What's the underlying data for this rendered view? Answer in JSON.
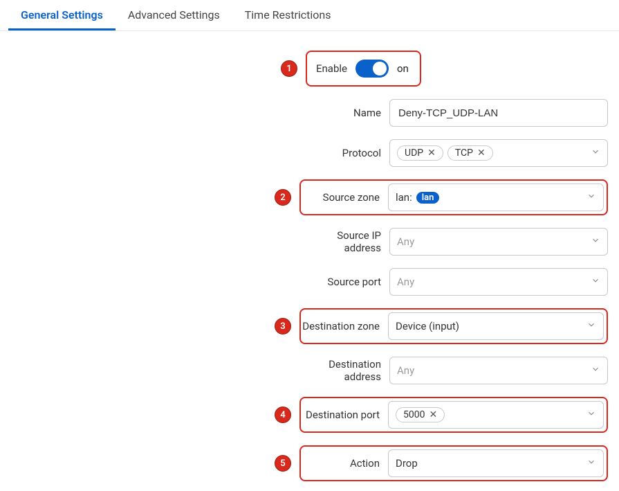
{
  "tabs": {
    "general": "General Settings",
    "advanced": "Advanced Settings",
    "time": "Time Restrictions"
  },
  "markers": {
    "m1": "1",
    "m2": "2",
    "m3": "3",
    "m4": "4",
    "m5": "5"
  },
  "form": {
    "enable": {
      "label": "Enable",
      "state": "on"
    },
    "name": {
      "label": "Name",
      "value": "Deny-TCP_UDP-LAN"
    },
    "protocol": {
      "label": "Protocol",
      "chips": [
        "UDP",
        "TCP"
      ]
    },
    "source_zone": {
      "label": "Source zone",
      "prefix": "lan:",
      "pill": "lan"
    },
    "source_ip": {
      "label": "Source IP address",
      "placeholder": "Any"
    },
    "source_port": {
      "label": "Source port",
      "placeholder": "Any"
    },
    "dest_zone": {
      "label": "Destination zone",
      "value": "Device (input)"
    },
    "dest_address": {
      "label": "Destination address",
      "placeholder": "Any"
    },
    "dest_port": {
      "label": "Destination port",
      "chips": [
        "5000"
      ]
    },
    "action": {
      "label": "Action",
      "value": "Drop"
    }
  }
}
